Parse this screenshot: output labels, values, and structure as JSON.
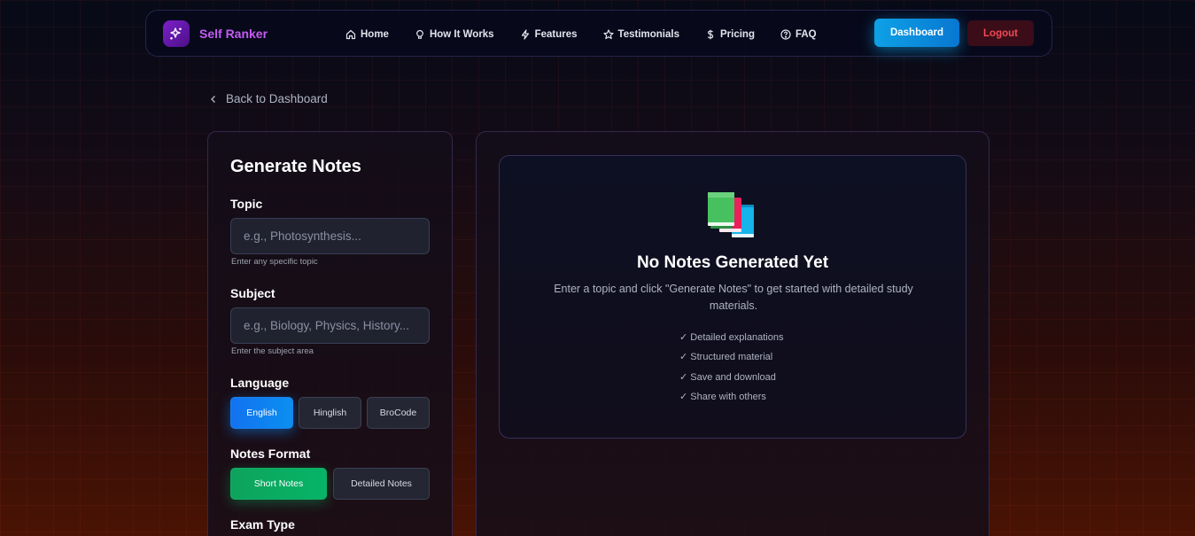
{
  "nav": {
    "brand": "Self Ranker",
    "links": [
      {
        "label": "Home",
        "icon": "home-icon"
      },
      {
        "label": "How It Works",
        "icon": "lightbulb-icon"
      },
      {
        "label": "Features",
        "icon": "lightning-icon"
      },
      {
        "label": "Testimonials",
        "icon": "star-icon"
      },
      {
        "label": "Pricing",
        "icon": "dollar-icon"
      },
      {
        "label": "FAQ",
        "icon": "help-circle-icon"
      }
    ],
    "dashboard_label": "Dashboard",
    "logout_label": "Logout"
  },
  "back_link": "Back to Dashboard",
  "form": {
    "title": "Generate Notes",
    "topic": {
      "label": "Topic",
      "placeholder": "e.g., Photosynthesis...",
      "helper": "Enter any specific topic"
    },
    "subject": {
      "label": "Subject",
      "placeholder": "e.g., Biology, Physics, History...",
      "helper": "Enter the subject area"
    },
    "language": {
      "label": "Language",
      "options": [
        "English",
        "Hinglish",
        "BroCode"
      ],
      "selected": "English"
    },
    "notes_format": {
      "label": "Notes Format",
      "options": [
        "Short Notes",
        "Detailed Notes"
      ],
      "selected": "Short Notes"
    },
    "exam_type": {
      "label": "Exam Type"
    }
  },
  "empty_state": {
    "icon": "books-icon",
    "title": "No Notes Generated Yet",
    "description": "Enter a topic and click \"Generate Notes\" to get started with detailed study materials.",
    "features": [
      "✓ Detailed explanations",
      "✓ Structured material",
      "✓ Save and download",
      "✓ Share with others"
    ]
  },
  "colors": {
    "brand": "#c55cf2",
    "primary": "#0ea1e6",
    "logout": "#f04a55",
    "language_active": "#1272f0",
    "format_active": "#0ea35d"
  }
}
